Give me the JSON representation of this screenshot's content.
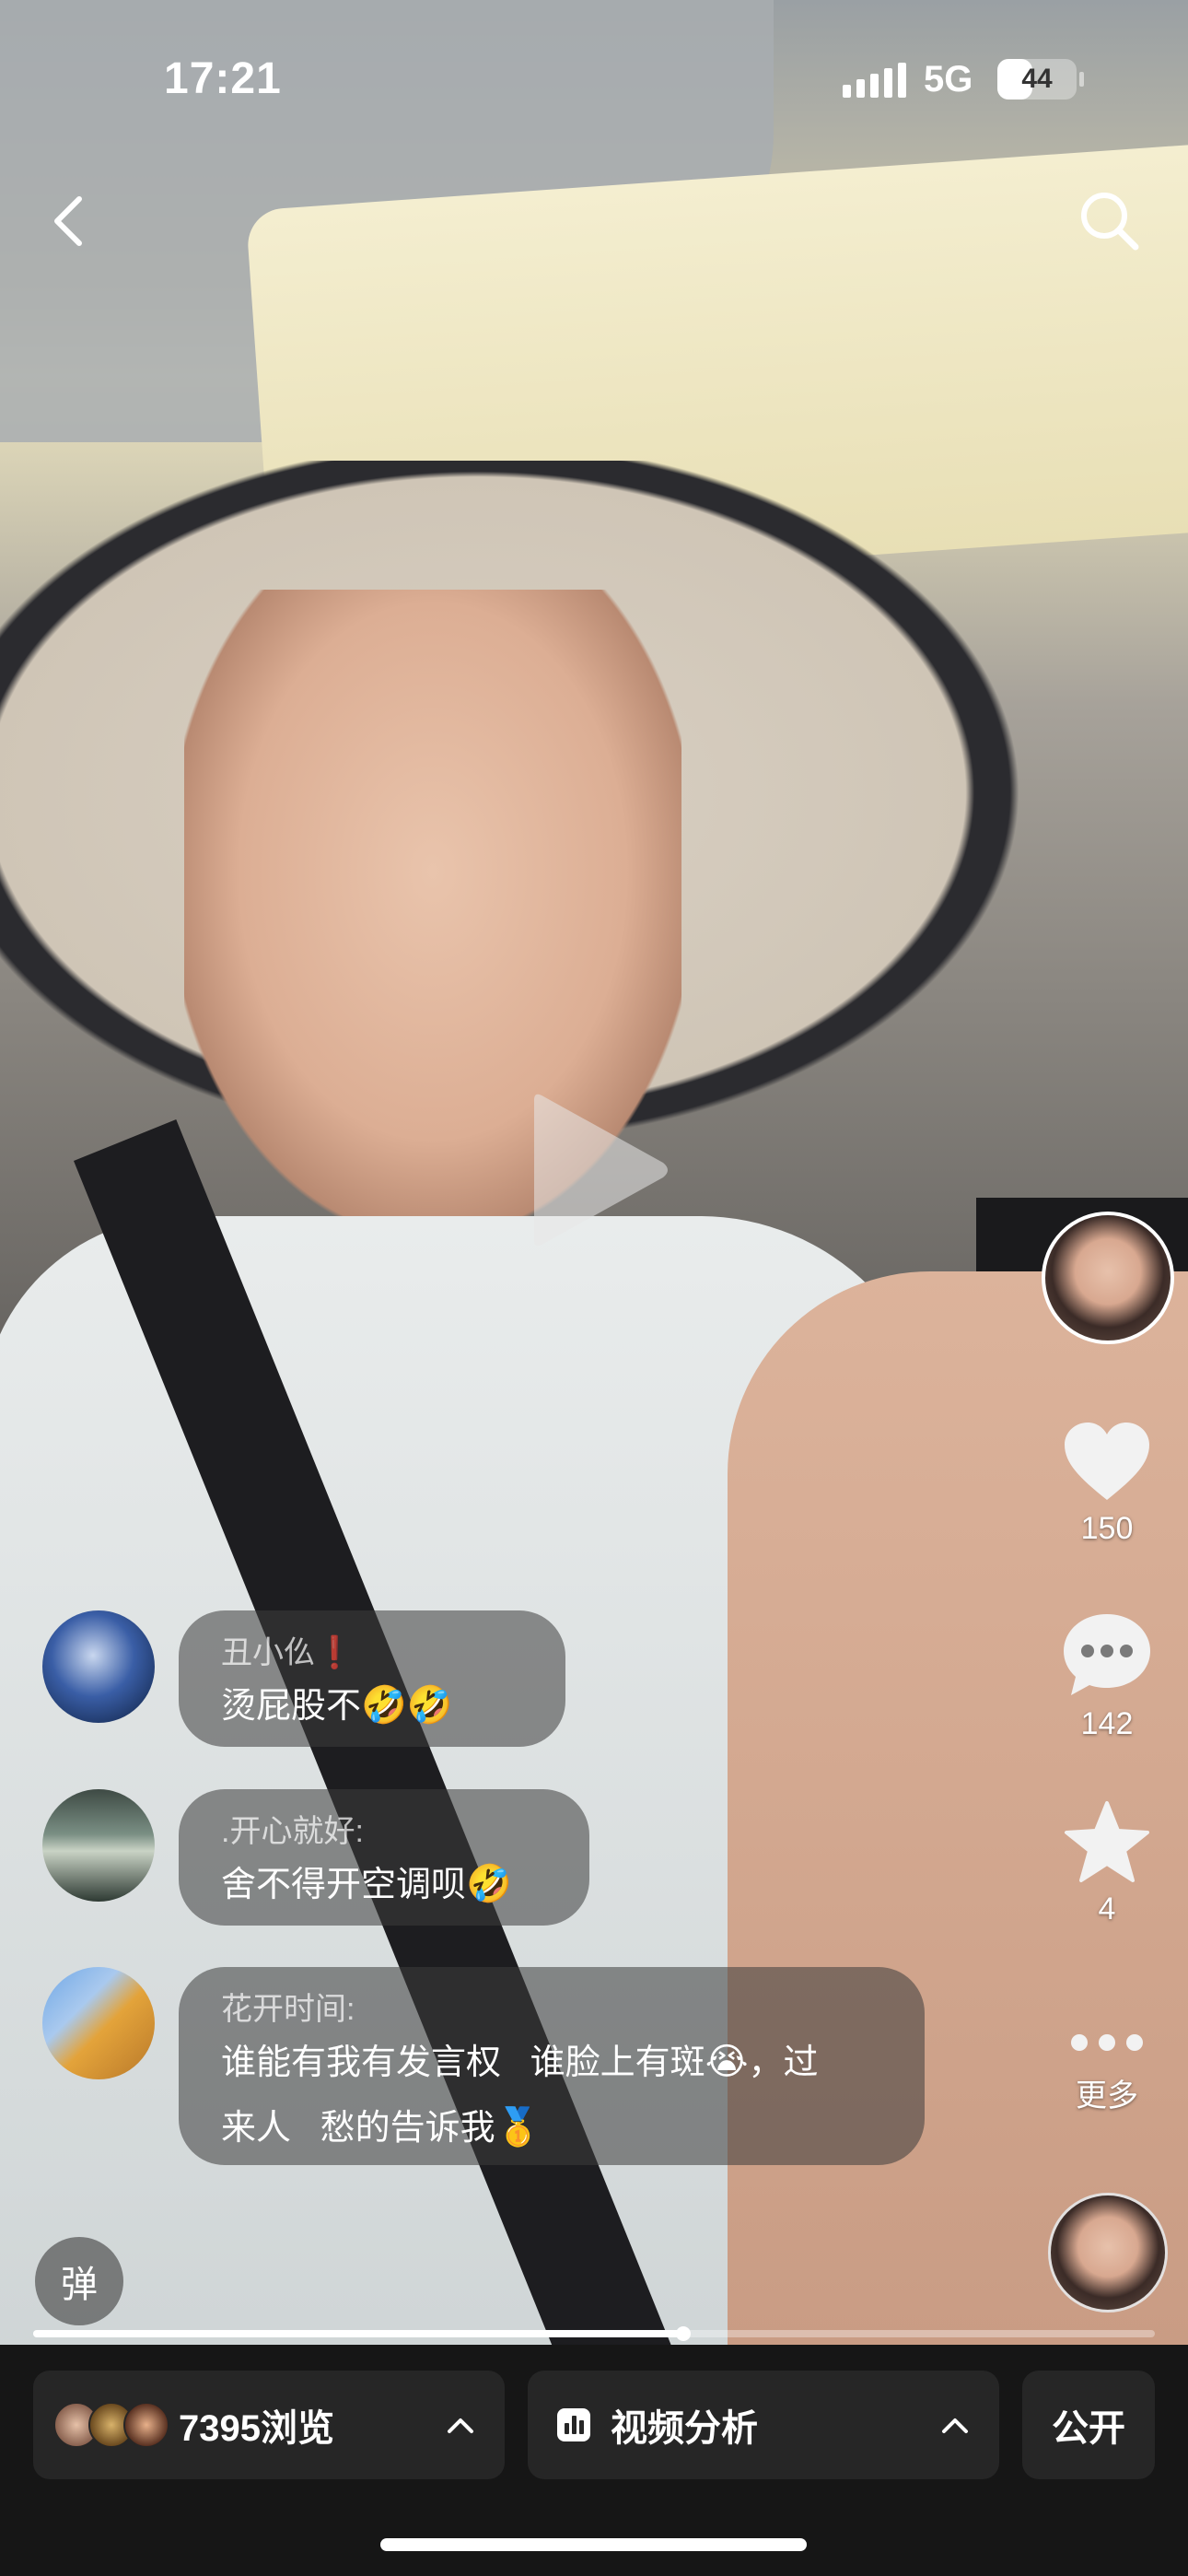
{
  "status_bar": {
    "time": "17:21",
    "network": "5G",
    "battery": "44",
    "battery_level": 0.44
  },
  "icons": {
    "back": "chevron-left-icon",
    "search": "search-icon",
    "play": "play-icon",
    "like": "heart-icon",
    "comment": "comment-bubble-icon",
    "favorite": "star-icon",
    "more": "more-dots-icon",
    "analysis": "bar-chart-icon",
    "expand": "chevron-up-icon"
  },
  "sidebar": {
    "likes": "150",
    "comments": "142",
    "favorites": "4",
    "more_label": "更多"
  },
  "comments": [
    {
      "user": "丑小仫❗",
      "text": "烫屁股不",
      "emoji": "🤣🤣"
    },
    {
      "user": ".开心就好:",
      "text": "舍不得开空调呗",
      "emoji": "🤣"
    },
    {
      "user": "花开时间:",
      "line1": "谁能有我有发言权   谁脸上有斑",
      "emoji1": "😭",
      "line1b": "，过",
      "line2": "来人   愁的告诉我",
      "emoji2": "🥇"
    }
  ],
  "danmu_label": "弹",
  "progress": 0.58,
  "bottom_bar": {
    "views_label": "7395浏览",
    "analysis_label": "视频分析",
    "public_label": "公开"
  },
  "colors": {
    "bar_bg": "#161616",
    "pill_bg": "#262626",
    "bubble_bg": "rgba(60,60,60,.55)"
  }
}
